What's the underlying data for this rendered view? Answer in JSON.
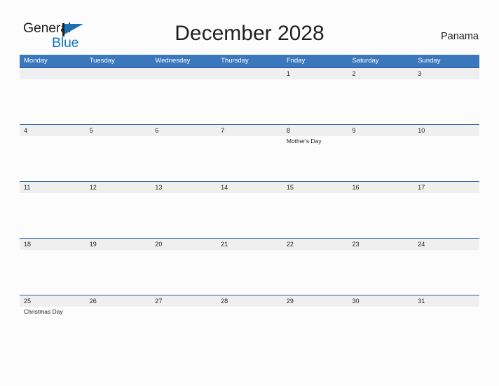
{
  "brand": {
    "name_part1": "General",
    "name_part2": "Blue",
    "flag_icon": "blue-triangle-flag-icon"
  },
  "header": {
    "title": "December 2028",
    "country": "Panama"
  },
  "calendar": {
    "weekday_headers": [
      "Monday",
      "Tuesday",
      "Wednesday",
      "Thursday",
      "Friday",
      "Saturday",
      "Sunday"
    ],
    "weeks": [
      {
        "days": [
          {
            "date": "",
            "event": ""
          },
          {
            "date": "",
            "event": ""
          },
          {
            "date": "",
            "event": ""
          },
          {
            "date": "",
            "event": ""
          },
          {
            "date": "1",
            "event": ""
          },
          {
            "date": "2",
            "event": ""
          },
          {
            "date": "3",
            "event": ""
          }
        ]
      },
      {
        "days": [
          {
            "date": "4",
            "event": ""
          },
          {
            "date": "5",
            "event": ""
          },
          {
            "date": "6",
            "event": ""
          },
          {
            "date": "7",
            "event": ""
          },
          {
            "date": "8",
            "event": "Mother's Day"
          },
          {
            "date": "9",
            "event": ""
          },
          {
            "date": "10",
            "event": ""
          }
        ]
      },
      {
        "days": [
          {
            "date": "11",
            "event": ""
          },
          {
            "date": "12",
            "event": ""
          },
          {
            "date": "13",
            "event": ""
          },
          {
            "date": "14",
            "event": ""
          },
          {
            "date": "15",
            "event": ""
          },
          {
            "date": "16",
            "event": ""
          },
          {
            "date": "17",
            "event": ""
          }
        ]
      },
      {
        "days": [
          {
            "date": "18",
            "event": ""
          },
          {
            "date": "19",
            "event": ""
          },
          {
            "date": "20",
            "event": ""
          },
          {
            "date": "21",
            "event": ""
          },
          {
            "date": "22",
            "event": ""
          },
          {
            "date": "23",
            "event": ""
          },
          {
            "date": "24",
            "event": ""
          }
        ]
      },
      {
        "days": [
          {
            "date": "25",
            "event": "Christmas Day"
          },
          {
            "date": "26",
            "event": ""
          },
          {
            "date": "27",
            "event": ""
          },
          {
            "date": "28",
            "event": ""
          },
          {
            "date": "29",
            "event": ""
          },
          {
            "date": "30",
            "event": ""
          },
          {
            "date": "31",
            "event": ""
          }
        ]
      }
    ]
  },
  "colors": {
    "header_blue": "#3b77bd",
    "strip_border_blue": "#2a6099",
    "strip_gray": "#efefef",
    "brand_blue": "#1278be",
    "text_dark": "#231f20",
    "page_background": "#fcfcfd"
  }
}
